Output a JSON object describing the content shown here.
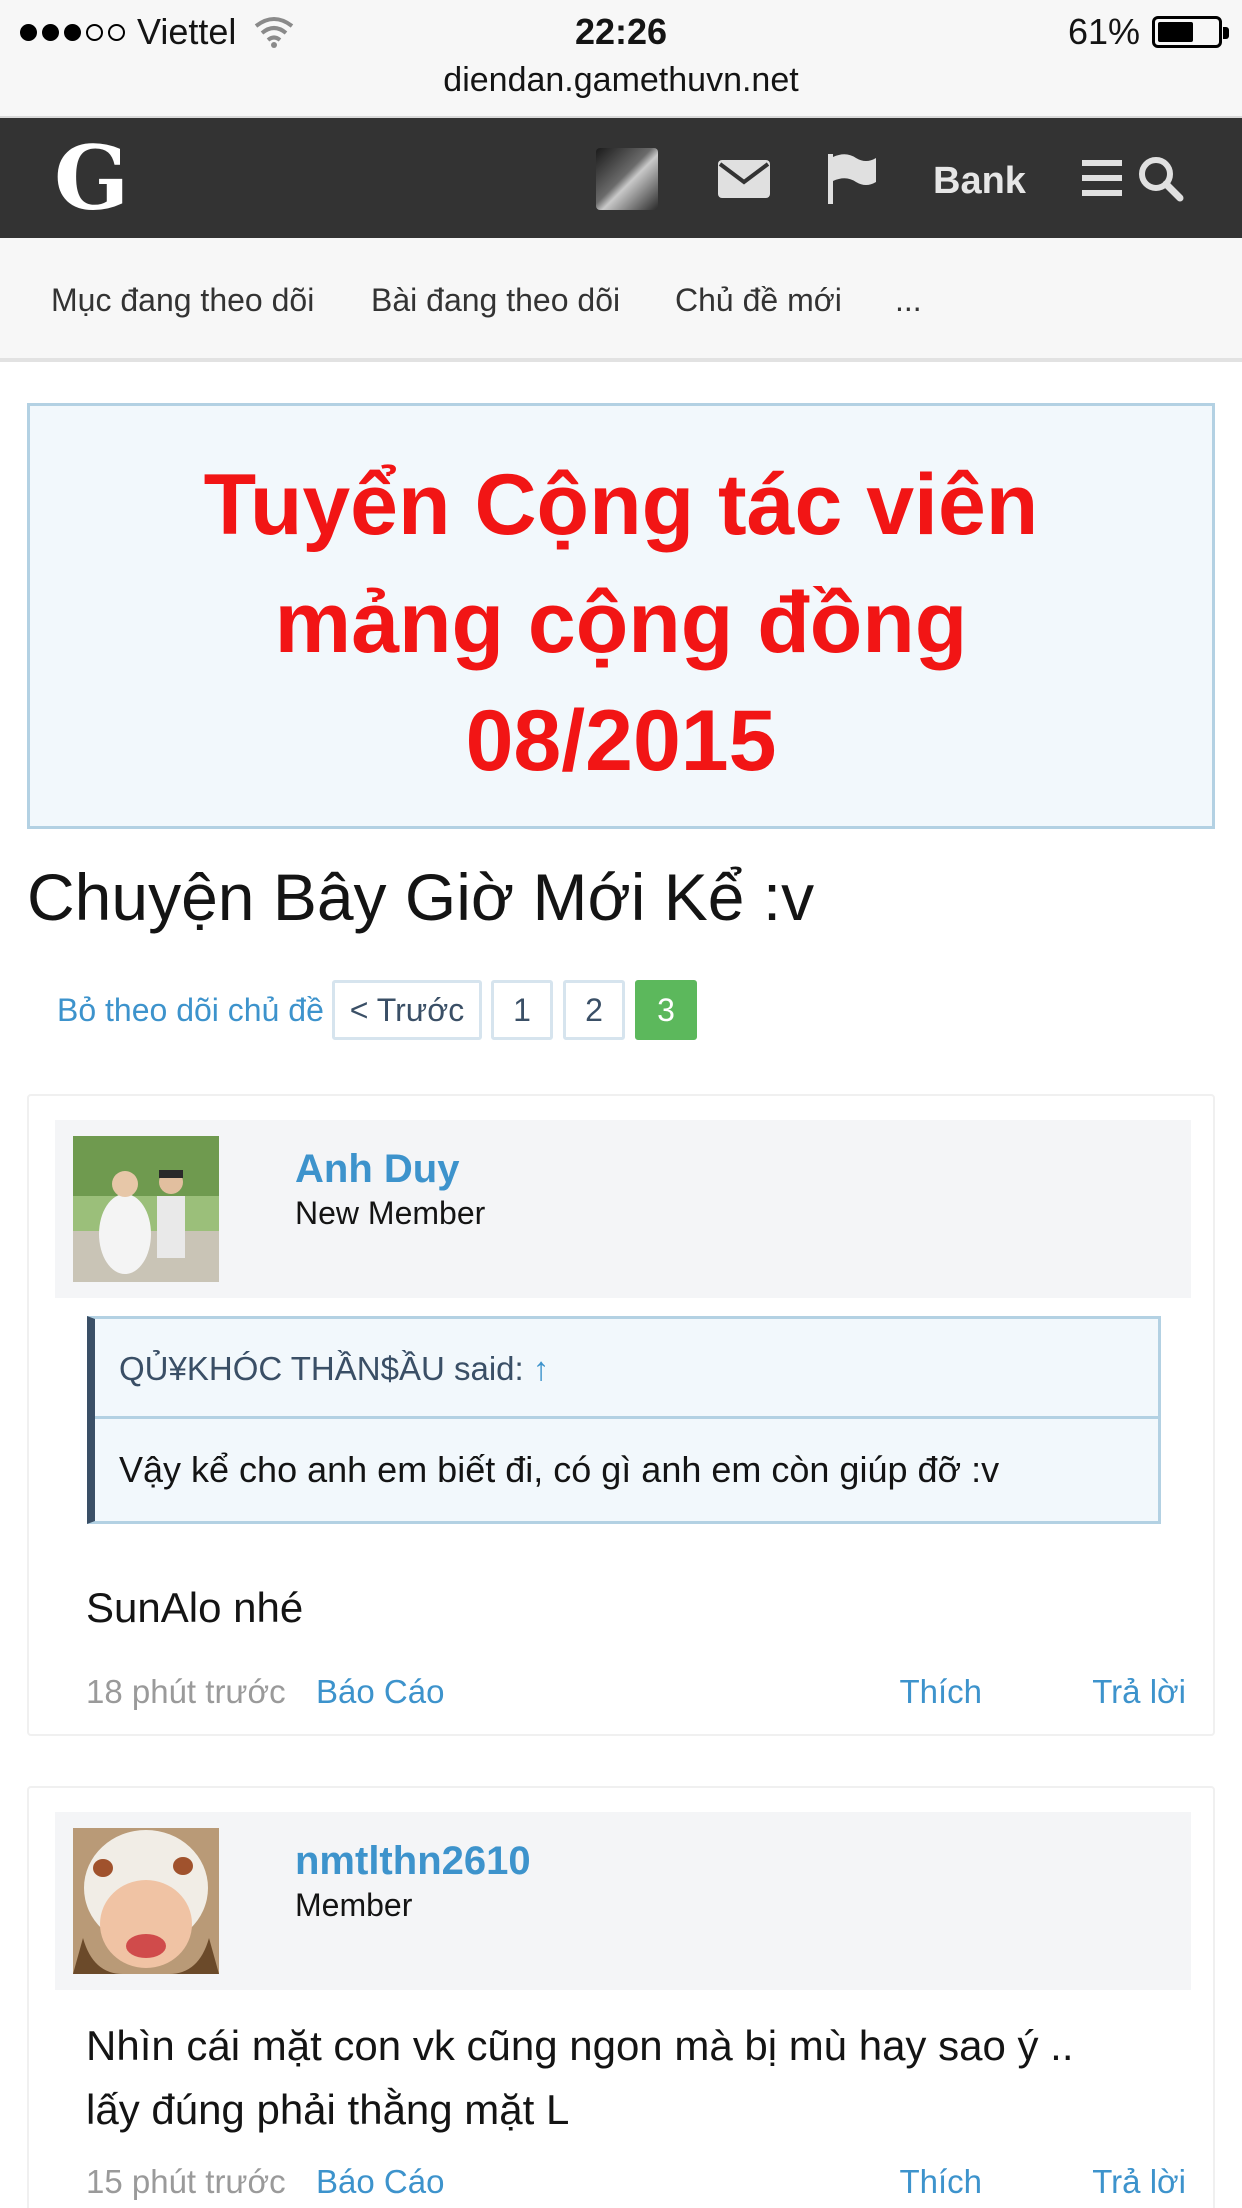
{
  "status_bar": {
    "carrier": "Viettel",
    "signal_bars_filled": 3,
    "signal_bars_total": 5,
    "time": "22:26",
    "battery_percent_text": "61%",
    "battery_level": 0.61
  },
  "browser": {
    "url": "diendan.gamethuvn.net"
  },
  "navbar": {
    "logo": "G",
    "icons": [
      "avatar",
      "envelope-icon",
      "flag-icon",
      "menu-icon",
      "search-icon"
    ],
    "bank_label": "Bank",
    "background": "#333333"
  },
  "subnav": {
    "items": [
      "Mục đang theo dõi",
      "Bài đang theo dõi",
      "Chủ đề mới",
      "..."
    ]
  },
  "banner": {
    "lines": [
      "Tuyển Cộng tác viên",
      "mảng cộng đồng",
      "08/2015"
    ],
    "color": "#f21515"
  },
  "thread": {
    "title": "Chuyện Bây Giờ Mới Kể :v",
    "unfollow_label": "Bỏ theo dõi chủ đề",
    "pagination": {
      "prev_label": "< Trước",
      "pages": [
        "1",
        "2",
        "3"
      ],
      "current": "3",
      "active_color": "#5cb85c"
    }
  },
  "posts": [
    {
      "author": "Anh Duy",
      "rank": "New Member",
      "quote": {
        "author_line": "QỦ¥KHÓC THẦN$ẦU said:",
        "arrow": "↑",
        "text": "Vậy kể cho anh em biết đi, có gì anh em còn giúp đỡ :v"
      },
      "message": "SunAlo nhé",
      "time": "18 phút trước",
      "report": "Báo Cáo",
      "like": "Thích",
      "reply": "Trả lời"
    },
    {
      "author": "nmtlthn2610",
      "rank": "Member",
      "message_lines": [
        "Nhìn cái mặt con vk cũng ngon mà bị mù hay sao ý ..",
        "lấy đúng phải thằng mặt L"
      ],
      "time": "15 phút trước",
      "report": "Báo Cáo",
      "like": "Thích",
      "reply": "Trả lời"
    }
  ],
  "link_color": "#3d93cc"
}
